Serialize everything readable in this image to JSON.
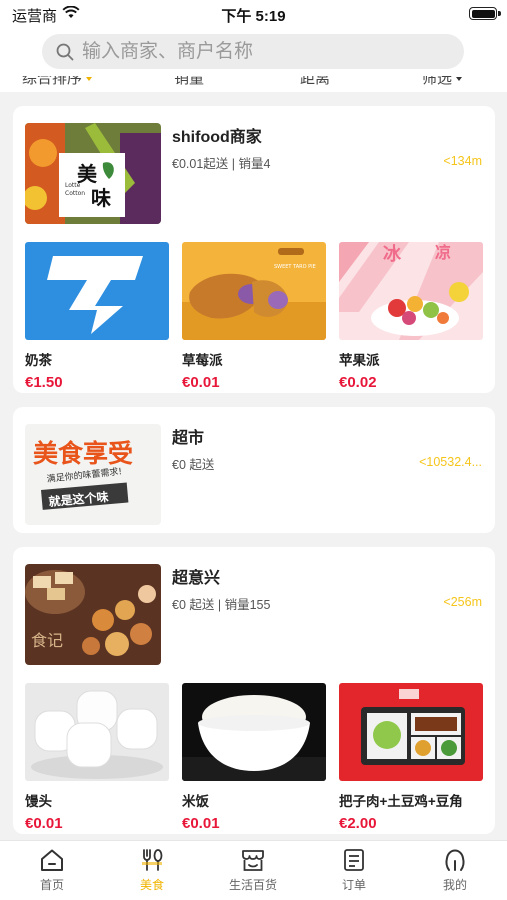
{
  "status_bar": {
    "carrier": "运营商",
    "time": "下午 5:19"
  },
  "search": {
    "placeholder": "输入商家、商户名称"
  },
  "sort_bar": {
    "items": [
      "综合排序",
      "销量",
      "距离",
      "筛选"
    ]
  },
  "shops": [
    {
      "name": "shifood商家",
      "meta": "€0.01起送 | 销量4",
      "distance": "<134m",
      "image_text": {
        "line1": "美",
        "line2": "味",
        "small": "Lotte Cotton"
      },
      "goods": [
        {
          "name": "奶茶",
          "price": "€1.50"
        },
        {
          "name": "草莓派",
          "price": "€0.01",
          "image_text": "SWEET TARO PIE"
        },
        {
          "name": "苹果派",
          "price": "€0.02"
        }
      ]
    },
    {
      "name": "超市",
      "meta": "€0 起送",
      "distance": "<10532.4...",
      "image_text": {
        "line1": "美食享受",
        "line2": "满足你的味蕾需求!",
        "line3": "就是这个味"
      },
      "goods": []
    },
    {
      "name": "超意兴",
      "meta": "€0 起送 | 销量155",
      "distance": "<256m",
      "image_text": {
        "line1": "食记"
      },
      "goods": [
        {
          "name": "馒头",
          "price": "€0.01"
        },
        {
          "name": "米饭",
          "price": "€0.01"
        },
        {
          "name": "把子肉+土豆鸡+豆角",
          "price": "€2.00"
        }
      ]
    }
  ],
  "tabs": [
    {
      "label": "首页",
      "icon": "home-icon",
      "active": false
    },
    {
      "label": "美食",
      "icon": "food-icon",
      "active": true
    },
    {
      "label": "生活百货",
      "icon": "store-icon",
      "active": false
    },
    {
      "label": "订单",
      "icon": "order-icon",
      "active": false
    },
    {
      "label": "我的",
      "icon": "profile-icon",
      "active": false
    }
  ],
  "colors": {
    "accent": "#f0b400",
    "price": "#e8173a",
    "distance": "#f5c51b"
  }
}
